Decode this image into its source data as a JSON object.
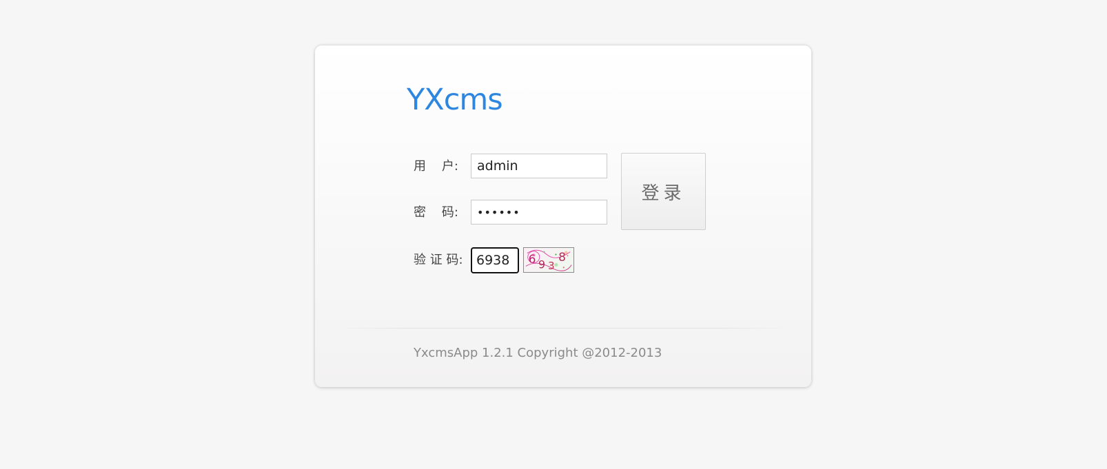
{
  "logo": {
    "text": "YXcms",
    "color": "#2d86e0"
  },
  "form": {
    "username": {
      "label": "用    户:",
      "value": "admin"
    },
    "password": {
      "label": "密    码:",
      "value": "••••••"
    },
    "captcha": {
      "label": "验 证 码:",
      "value": "6938",
      "image_text": "6938"
    },
    "login_button": "登录"
  },
  "footer": {
    "copyright": "YxcmsApp 1.2.1 Copyright @2012-2013"
  }
}
